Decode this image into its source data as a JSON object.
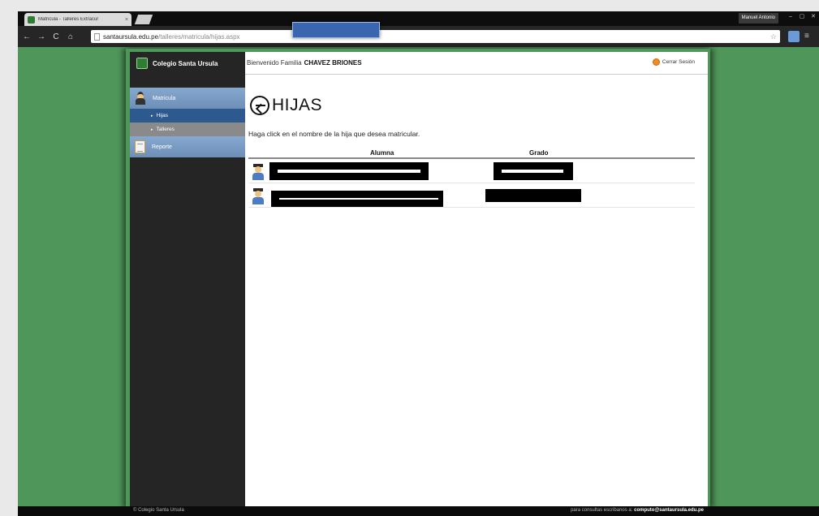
{
  "browser": {
    "tab_title": "Matricula - Talleres Extracur",
    "tab_close": "×",
    "user": "Manuel Antonio",
    "window_controls": [
      "–",
      "▢",
      "✕"
    ],
    "nav": {
      "back": "←",
      "forward": "→",
      "reload": "C",
      "home": "⌂"
    },
    "url_host": "santaursula.edu.pe",
    "url_path": "/talleres/matricula/hijas.aspx",
    "star": "☆",
    "menu": "≡"
  },
  "sidebar": {
    "brand": "Colegio Santa Ursula",
    "menu": [
      {
        "label": "Matricula",
        "icon": "student-icon"
      },
      {
        "label": "Hijas",
        "active": true
      },
      {
        "label": "Talleres",
        "active": false
      },
      {
        "label": "Reporte",
        "icon": "report-icon"
      }
    ]
  },
  "topbar": {
    "welcome": "Bienvenido Familia",
    "family_name": "CHAVEZ BRIONES",
    "logout": "Cerrar Sesión"
  },
  "main": {
    "title": "HIJAS",
    "instructions": "Haga click en el nombre de la hija que desea matricular.",
    "columns": {
      "student": "Alumna",
      "grade": "Grado"
    }
  },
  "footer": {
    "left": "© Colegio Santa Ursula",
    "right_prefix": "para consultas escribanos a:",
    "right_email": "computo@santaursula.edu.pe"
  }
}
